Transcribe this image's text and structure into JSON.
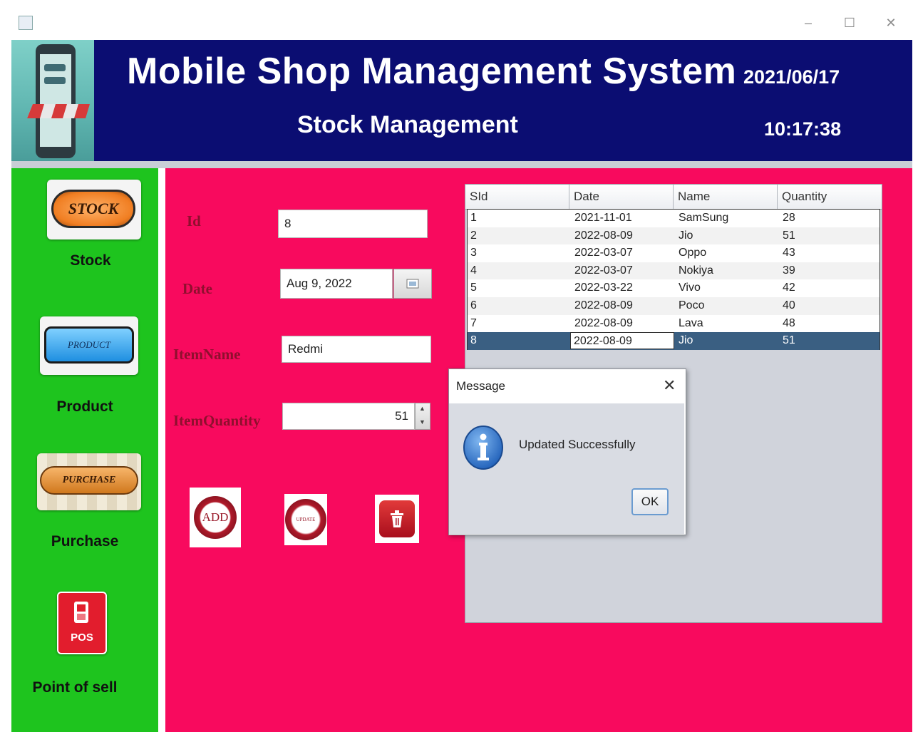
{
  "window": {
    "controls": {
      "minimize": "–",
      "maximize": "☐",
      "close": "✕"
    }
  },
  "header": {
    "title": "Mobile Shop Management System",
    "subtitle": "Stock Management",
    "date": "2021/06/17",
    "time": "10:17:38"
  },
  "sidebar": {
    "items": [
      {
        "label": "Stock",
        "button_text": "STOCK"
      },
      {
        "label": "Product",
        "button_text": "PRODUCT"
      },
      {
        "label": "Purchase",
        "button_text": "PURCHASE"
      },
      {
        "label": "Point of sell",
        "button_text": "POS"
      }
    ]
  },
  "form": {
    "id_label": "Id",
    "id_value": "8",
    "date_label": "Date",
    "date_value": "Aug 9, 2022",
    "item_name_label": "ItemName",
    "item_name_value": "Redmi",
    "item_quantity_label": "ItemQuantity",
    "item_quantity_value": "51",
    "buttons": {
      "add": "ADD",
      "update": "UPDATE"
    }
  },
  "table": {
    "columns": [
      "SId",
      "Date",
      "Name",
      "Quantity"
    ],
    "rows": [
      [
        "1",
        "2021-11-01",
        "SamSung",
        "28"
      ],
      [
        "2",
        "2022-08-09",
        "Jio",
        "51"
      ],
      [
        "3",
        "2022-03-07",
        "Oppo",
        "43"
      ],
      [
        "4",
        "2022-03-07",
        "Nokiya",
        "39"
      ],
      [
        "5",
        "2022-03-22",
        "Vivo",
        "42"
      ],
      [
        "6",
        "2022-08-09",
        "Poco",
        "40"
      ],
      [
        "7",
        "2022-08-09",
        "Lava",
        "48"
      ],
      [
        "8",
        "2022-08-09",
        "Jio",
        "51"
      ]
    ],
    "selected_row": 7
  },
  "dialog": {
    "title": "Message",
    "message": "Updated Successfully",
    "ok_label": "OK",
    "icon": "info-icon"
  },
  "colors": {
    "header_bg": "#0b0d72",
    "sidebar_bg": "#1ec41e",
    "main_bg": "#f80a5e",
    "label_color": "#8f0f2e",
    "selected_row": "#3a5f82"
  }
}
